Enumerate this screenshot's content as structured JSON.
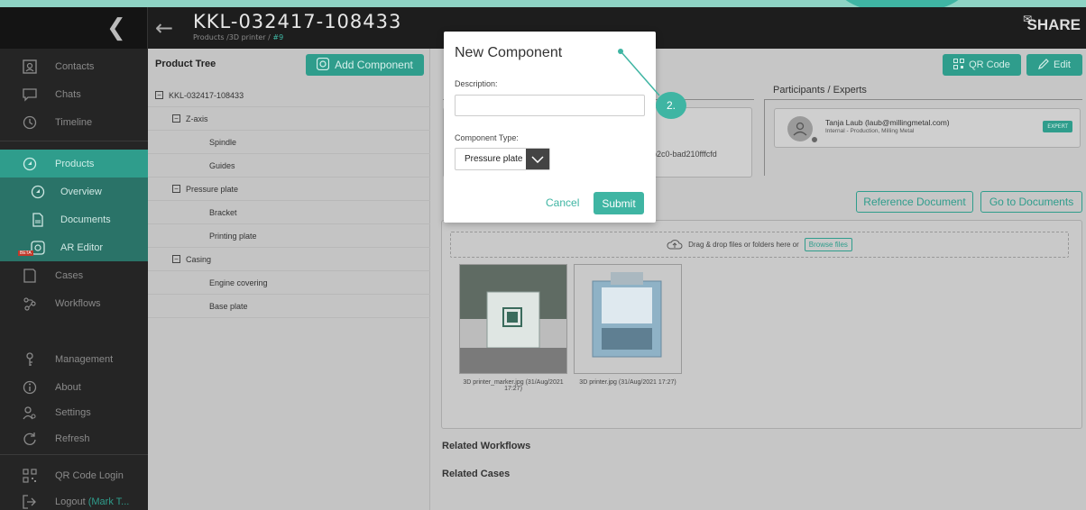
{
  "header": {
    "title": "KKL-032417-108433",
    "breadcrumb": "Products /3D printer /",
    "breadcrumb_accent": "#9",
    "brand": "SHARE"
  },
  "sidebar": {
    "items": [
      {
        "label": "Contacts",
        "icon": "contacts-icon"
      },
      {
        "label": "Chats",
        "icon": "chat-icon"
      },
      {
        "label": "Timeline",
        "icon": "clock-icon"
      },
      {
        "label": "Products",
        "icon": "product-icon"
      },
      {
        "label": "Overview",
        "icon": "overview-icon"
      },
      {
        "label": "Documents",
        "icon": "document-icon"
      },
      {
        "label": "AR Editor",
        "icon": "ar-editor-icon",
        "badge": "BETA"
      },
      {
        "label": "Cases",
        "icon": "cases-icon"
      },
      {
        "label": "Workflows",
        "icon": "workflows-icon"
      },
      {
        "label": "Management",
        "icon": "management-icon"
      },
      {
        "label": "About",
        "icon": "info-icon"
      },
      {
        "label": "Settings",
        "icon": "settings-icon"
      },
      {
        "label": "Refresh",
        "icon": "refresh-icon"
      },
      {
        "label": "QR Code Login",
        "icon": "qr-icon"
      },
      {
        "label": "Logout",
        "icon": "logout-icon",
        "extra": "(Mark T..."
      }
    ]
  },
  "product_tree": {
    "heading": "Product Tree",
    "add_button": "Add Component",
    "rows": [
      {
        "label": "KKL-032417-108433",
        "level": 0,
        "toggle": true
      },
      {
        "label": "Z-axis",
        "level": 1,
        "toggle": true
      },
      {
        "label": "Spindle",
        "level": 2,
        "toggle": false
      },
      {
        "label": "Guides",
        "level": 2,
        "toggle": false
      },
      {
        "label": "Pressure plate",
        "level": 1,
        "toggle": true
      },
      {
        "label": "Bracket",
        "level": 2,
        "toggle": false
      },
      {
        "label": "Printing plate",
        "level": 2,
        "toggle": false
      },
      {
        "label": "Casing",
        "level": 1,
        "toggle": true
      },
      {
        "label": "Engine covering",
        "level": 2,
        "toggle": false
      },
      {
        "label": "Base plate",
        "level": 2,
        "toggle": false
      }
    ]
  },
  "content": {
    "qr_button": "QR Code",
    "edit_button": "Edit",
    "participants_title": "Participants / Experts",
    "participant_name": "Tanja Laub (laub@millingmetal.com)",
    "participant_org": "Internal - Production, Milling Metal",
    "expert_badge": "EXPERT",
    "id_fragment": "-b2c0-bad210fffcfd",
    "reference_button": "Reference Document",
    "documents_button": "Go to Documents",
    "dropzone_text": "Drag & drop files or folders here or",
    "browse_button": "Browse files",
    "files": [
      {
        "caption": "3D printer_marker.jpg (31/Aug/2021 17:27)"
      },
      {
        "caption": "3D printer.jpg (31/Aug/2021 17:27)"
      }
    ],
    "related_workflows": "Related Workflows",
    "related_cases": "Related Cases"
  },
  "modal": {
    "title": "New Component",
    "description_label": "Description:",
    "description_value": "",
    "type_label": "Component Type:",
    "type_value": "Pressure plate",
    "cancel": "Cancel",
    "submit": "Submit"
  },
  "annotation": {
    "step": "2."
  },
  "colors": {
    "accent": "#3fb5a3",
    "accent_dark": "#2f9d8c",
    "sidebar_bg": "#252525",
    "header_bg": "#1d1d1d"
  }
}
